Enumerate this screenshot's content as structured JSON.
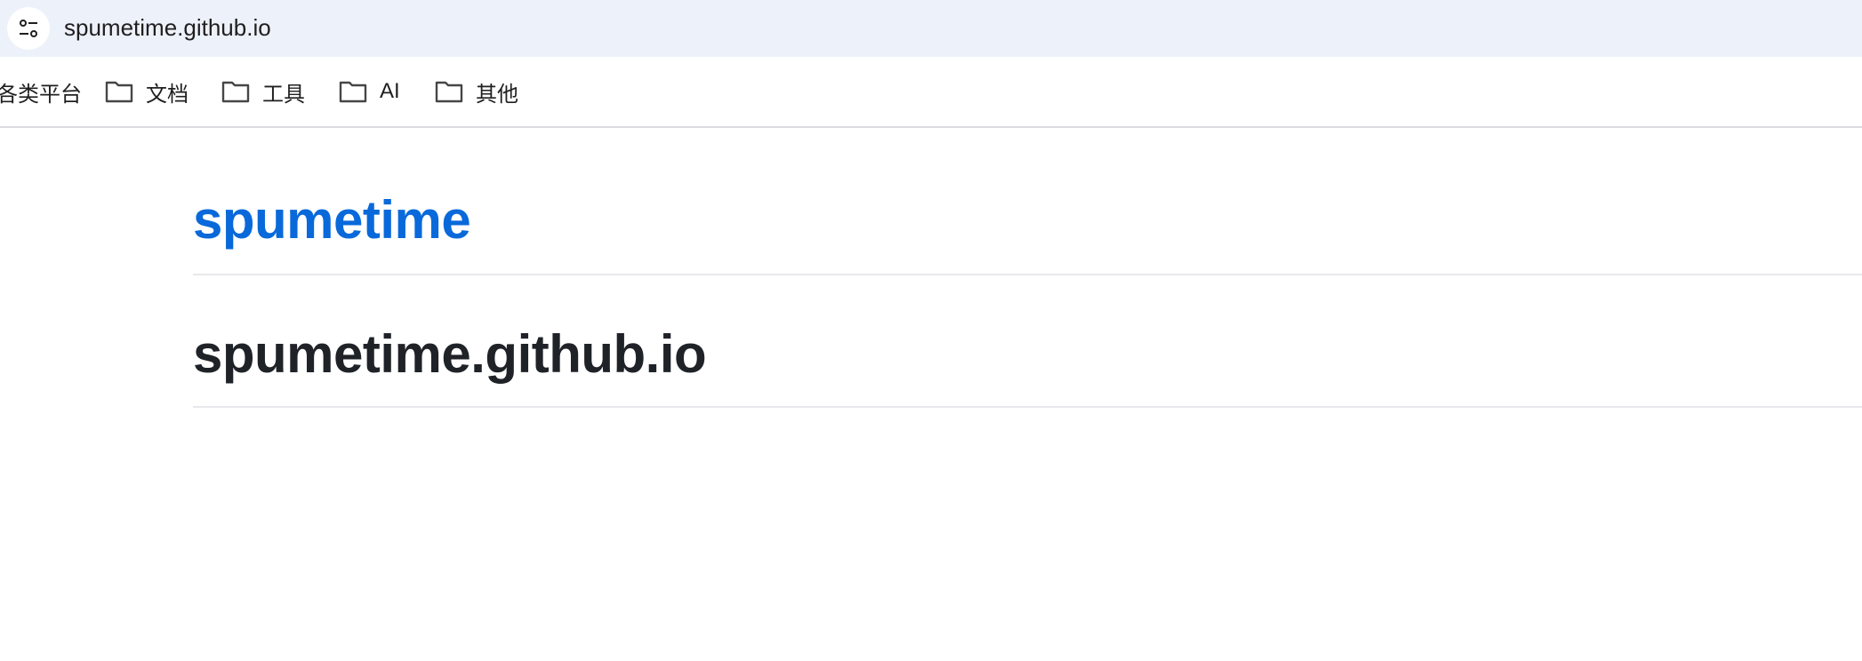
{
  "browser": {
    "url": "spumetime.github.io",
    "site_info_icon": "tune-icon"
  },
  "bookmarks": {
    "items": [
      {
        "label": "各类平台",
        "icon": "none"
      },
      {
        "label": "文档",
        "icon": "folder-icon"
      },
      {
        "label": "工具",
        "icon": "folder-icon"
      },
      {
        "label": "AI",
        "icon": "folder-icon"
      },
      {
        "label": "其他",
        "icon": "folder-icon"
      }
    ]
  },
  "page": {
    "site_title": "spumetime",
    "heading": "spumetime.github.io"
  },
  "colors": {
    "address_bar_bg": "#edf1f9",
    "link": "#0969da",
    "heading": "#1f2328",
    "rule": "#e6e8eb"
  }
}
